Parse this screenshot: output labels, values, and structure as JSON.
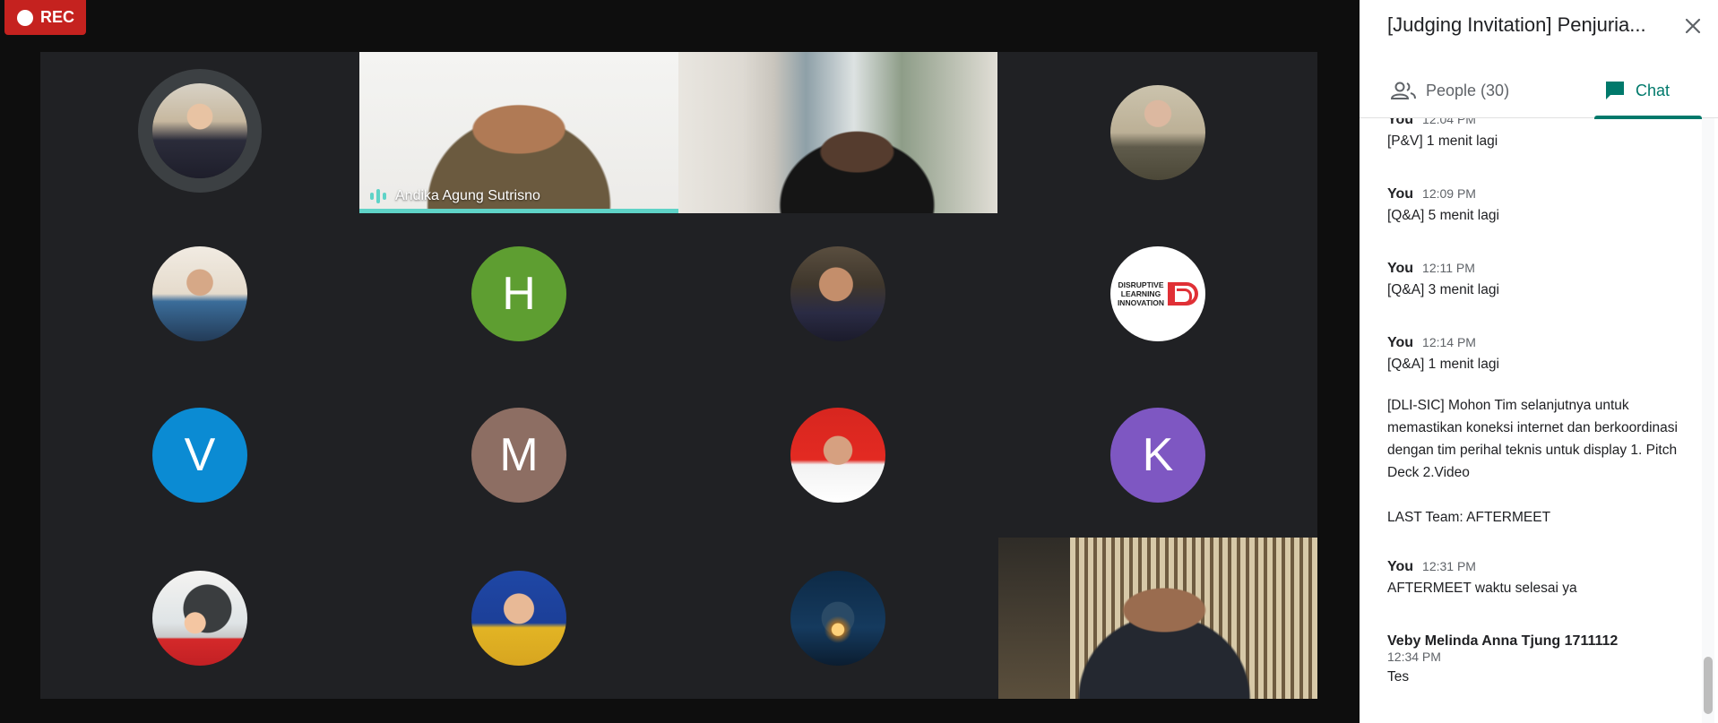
{
  "recording": {
    "label": "REC"
  },
  "participants": {
    "speaking_name": "Andika Agung Sutrisno",
    "letters": {
      "h": "H",
      "v": "V",
      "m": "M",
      "k": "K"
    },
    "colors": {
      "h": "#5e9e31",
      "v": "#0b8bd3",
      "m": "#8d6e63",
      "k": "#7e57c2",
      "speaking": "#5fd3c7"
    },
    "logo_text": "DISRUPTIVE LEARNING INNOVATION"
  },
  "panel": {
    "title": "[Judging Invitation] Penjuria...",
    "tabs": {
      "people": "People (30)",
      "chat": "Chat"
    },
    "messages": [
      {
        "sender": "You",
        "time": "12:04 PM",
        "text": "[P&V] 1 menit lagi"
      },
      {
        "sender": "You",
        "time": "12:09 PM",
        "text": "[Q&A] 5 menit lagi"
      },
      {
        "sender": "You",
        "time": "12:11 PM",
        "text": "[Q&A] 3 menit lagi"
      },
      {
        "sender": "You",
        "time": "12:14 PM",
        "text": "[Q&A] 1 menit lagi"
      },
      {
        "text": "[DLI-SIC] Mohon Tim selanjutnya untuk memastikan koneksi internet dan berkoordinasi dengan tim perihal teknis untuk display 1. Pitch Deck 2.Video"
      },
      {
        "text": "LAST Team: AFTERMEET"
      },
      {
        "sender": "You",
        "time": "12:31 PM",
        "text": "AFTERMEET waktu selesai ya"
      },
      {
        "sender": "Veby Melinda Anna Tjung 1711112",
        "time": "12:34 PM",
        "text": "Tes"
      }
    ],
    "accent": "#00796b"
  }
}
